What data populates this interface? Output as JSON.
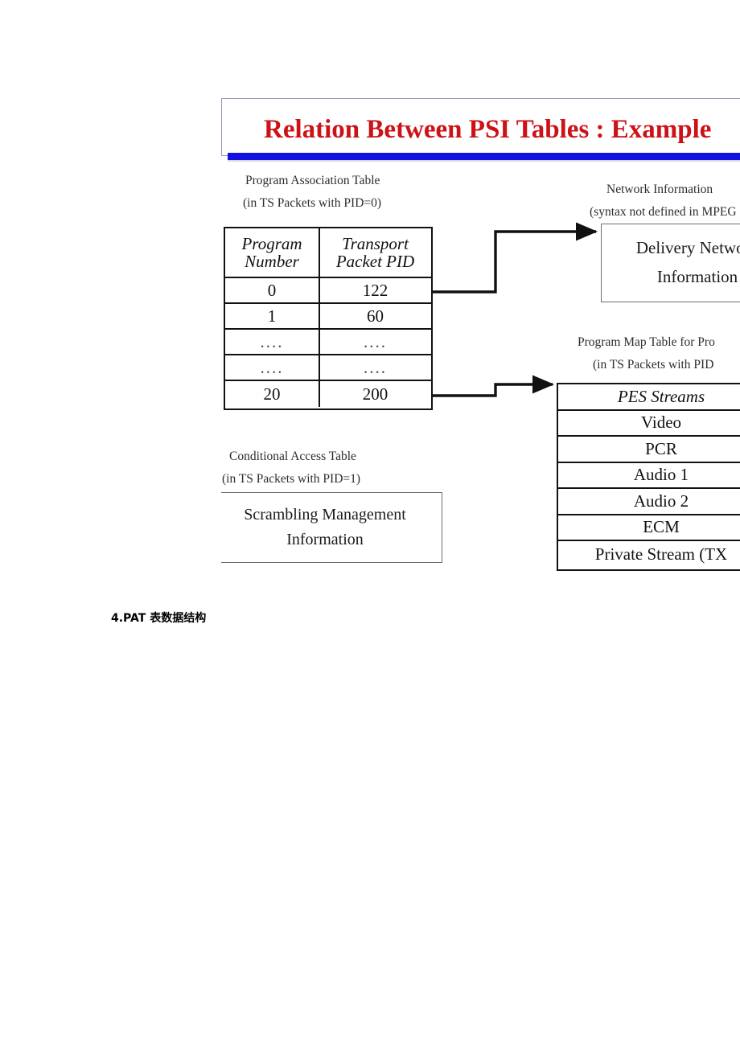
{
  "document": {
    "caption": "4.PAT 表数据结构"
  },
  "slide": {
    "title": "Relation Between PSI Tables : Example",
    "title_color": "#cc1216",
    "accent_bar_color": "#1211e0",
    "pat": {
      "label_line1": "Program Association Table",
      "label_line2": "(in TS Packets with PID=0)",
      "columns": [
        "Program Number",
        "Transport Packet PID"
      ],
      "column_lines": [
        [
          "Program",
          "Number"
        ],
        [
          "Transport",
          "Packet PID"
        ]
      ],
      "rows": [
        {
          "program_number": "0",
          "transport_packet_pid": "122"
        },
        {
          "program_number": "1",
          "transport_packet_pid": "60"
        },
        {
          "program_number": "....",
          "transport_packet_pid": "...."
        },
        {
          "program_number": "....",
          "transport_packet_pid": "...."
        },
        {
          "program_number": "20",
          "transport_packet_pid": "200"
        }
      ]
    },
    "cat": {
      "label_line1": "Conditional Access Table",
      "label_line2": "(in TS Packets with PID=1)",
      "box_line1": "Scrambling Management",
      "box_line2": "Information"
    },
    "nit": {
      "label_line1": "Network Information",
      "label_line2": "(syntax not defined in MPEG",
      "box_line1": "Delivery Network",
      "box_line2": "Information"
    },
    "pmt": {
      "label_line1": "Program Map Table for Pro",
      "label_line2": "(in TS Packets with PID",
      "header": "PES Streams",
      "rows": [
        "Video",
        "PCR",
        "Audio 1",
        "Audio 2",
        "ECM",
        "Private Stream (TX"
      ]
    }
  }
}
